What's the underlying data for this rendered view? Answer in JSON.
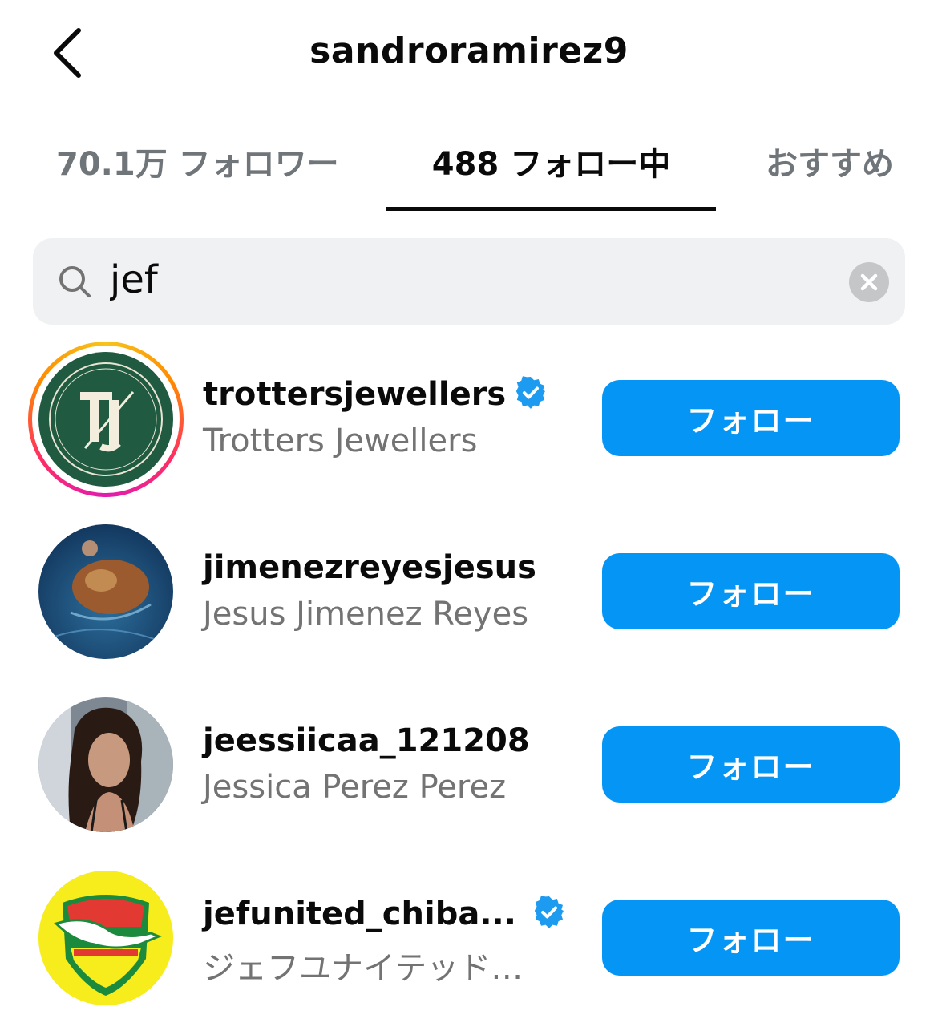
{
  "header": {
    "title": "sandroramirez9",
    "back_icon": "chevron-left-icon"
  },
  "tabs": [
    {
      "label": "70.1万 フォロワー",
      "active": false
    },
    {
      "label": "488 フォロー中",
      "active": true
    },
    {
      "label": "おすすめ",
      "active": false
    }
  ],
  "search": {
    "value": "jef",
    "search_icon": "magnifier-icon",
    "clear_icon": "clear-x-icon"
  },
  "colors": {
    "accent": "#0596f5",
    "verified": "#1d9bf0",
    "muted_text": "#737373"
  },
  "users": [
    {
      "username": "trottersjewellers",
      "full_name": "Trotters Jewellers",
      "verified": true,
      "has_story": true,
      "button": "フォロー",
      "avatar": "trotters-logo"
    },
    {
      "username": "jimenezreyesjesus",
      "full_name": "Jesus Jimenez Reyes",
      "verified": false,
      "has_story": false,
      "button": "フォロー",
      "avatar": "fish-photo"
    },
    {
      "username": "jeessiicaa_121208",
      "full_name": "Jessica Perez Perez",
      "verified": false,
      "has_story": false,
      "button": "フォロー",
      "avatar": "portrait-photo"
    },
    {
      "username": "jefunited_chiba...",
      "full_name": "ジェフユナイテッド…",
      "verified": true,
      "has_story": false,
      "button": "フォロー",
      "avatar": "jef-crest"
    }
  ]
}
